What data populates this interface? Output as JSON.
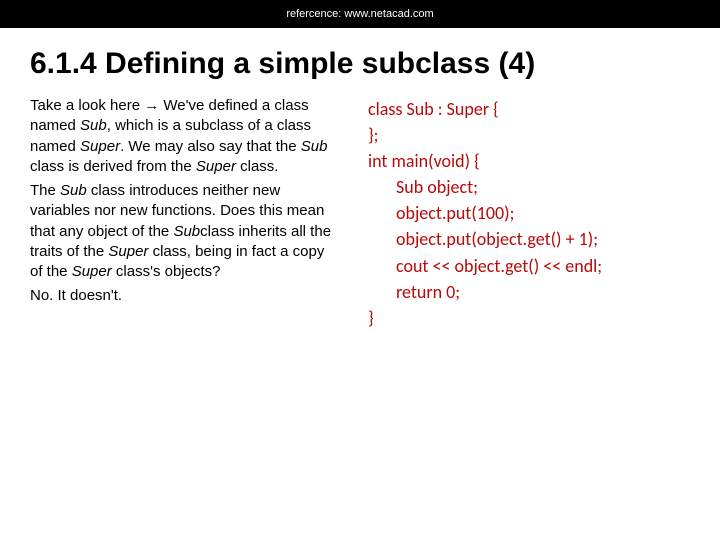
{
  "topbar": {
    "text": "refercence: www.netacad.com"
  },
  "title": "6.1.4 Defining a simple subclass (4)",
  "left": {
    "p1_a": "Take a look here → We've defined a class named ",
    "p1_sub": "Sub",
    "p1_b": ", which is a subclass of a class named ",
    "p1_super": "Super",
    "p1_c": ". We may also say that the ",
    "p1_sub2": "Sub",
    "p1_d": " class is derived from the ",
    "p1_super2": "Super",
    "p1_e": " class.",
    "p2_a": "The ",
    "p2_sub": "Sub",
    "p2_b": " class introduces neither new variables nor new functions. Does this mean that any object of the ",
    "p2_subcls": "Sub",
    "p2_c": "class inherits all the traits of the ",
    "p2_super": "Super",
    "p2_d": " class, being in fact a copy of the ",
    "p2_super2": "Super",
    "p2_e": " class's objects?",
    "p3": "No. It doesn't."
  },
  "code": {
    "l1": "class Sub : Super {",
    "l2": "};",
    "l3": "",
    "l4": "int main(void) {",
    "l5": "Sub object;",
    "l6": "",
    "l7": "object.put(100);",
    "l8": "object.put(object.get() + 1);",
    "l9": "cout << object.get() << endl;",
    "l10": "return 0;",
    "l11": "}"
  }
}
